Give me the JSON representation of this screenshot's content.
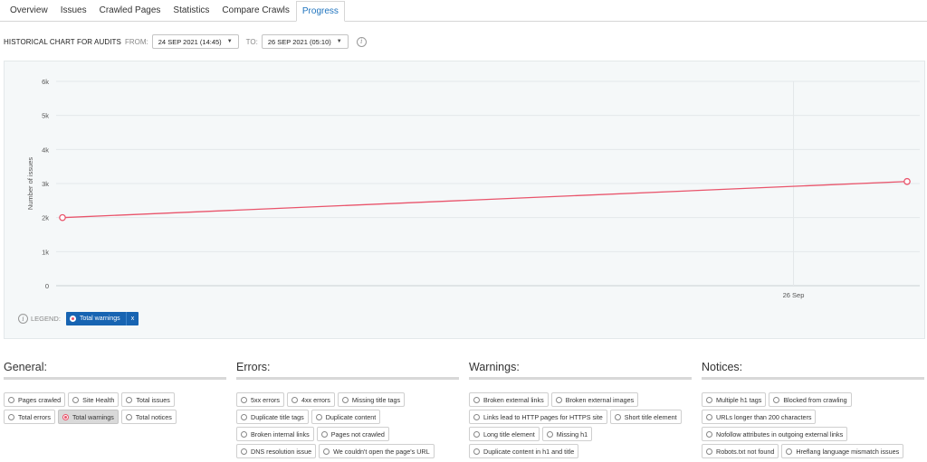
{
  "tabs": [
    {
      "label": "Overview",
      "active": false
    },
    {
      "label": "Issues",
      "active": false
    },
    {
      "label": "Crawled Pages",
      "active": false
    },
    {
      "label": "Statistics",
      "active": false
    },
    {
      "label": "Compare Crawls",
      "active": false
    },
    {
      "label": "Progress",
      "active": true
    }
  ],
  "history": {
    "title": "HISTORICAL CHART FOR AUDITS",
    "from_label": "FROM:",
    "from_value": "24 SEP 2021 (14:45)",
    "to_label": "TO:",
    "to_value": "26 SEP 2021 (05:10)"
  },
  "legend": {
    "label": "LEGEND:",
    "chip_label": "Total warnings",
    "chip_close": "x"
  },
  "colors": {
    "line": "#e9546b",
    "accent": "#1764b2",
    "tab_active": "#1e73be"
  },
  "chart_data": {
    "type": "line",
    "ylabel": "Number of issues",
    "xlabel": "",
    "ylim": [
      0,
      6000
    ],
    "yticks": [
      0,
      1000,
      2000,
      3000,
      4000,
      5000,
      6000
    ],
    "ytick_labels": [
      "0",
      "1k",
      "2k",
      "3k",
      "4k",
      "5k",
      "6k"
    ],
    "x_range": [
      "2021-09-24 14:45",
      "2021-09-26 05:10"
    ],
    "xtick_labels": [
      {
        "label": "26 Sep",
        "at": "2021-09-26 00:00"
      }
    ],
    "series": [
      {
        "name": "Total warnings",
        "x": [
          "2021-09-24 14:45",
          "2021-09-26 05:10"
        ],
        "values": [
          2000,
          3060
        ]
      }
    ]
  },
  "groups": [
    {
      "title": "General:",
      "options": [
        {
          "label": "Pages crawled",
          "selected": false
        },
        {
          "label": "Site Health",
          "selected": false
        },
        {
          "label": "Total issues",
          "selected": false
        },
        {
          "label": "Total errors",
          "selected": false
        },
        {
          "label": "Total warnings",
          "selected": true
        },
        {
          "label": "Total notices",
          "selected": false
        }
      ]
    },
    {
      "title": "Errors:",
      "options": [
        {
          "label": "5xx errors",
          "selected": false
        },
        {
          "label": "4xx errors",
          "selected": false
        },
        {
          "label": "Missing title tags",
          "selected": false
        },
        {
          "label": "Duplicate title tags",
          "selected": false
        },
        {
          "label": "Duplicate content",
          "selected": false
        },
        {
          "label": "Broken internal links",
          "selected": false
        },
        {
          "label": "Pages not crawled",
          "selected": false
        },
        {
          "label": "DNS resolution issue",
          "selected": false
        },
        {
          "label": "We couldn't open the page's URL",
          "selected": false
        }
      ]
    },
    {
      "title": "Warnings:",
      "options": [
        {
          "label": "Broken external links",
          "selected": false
        },
        {
          "label": "Broken external images",
          "selected": false
        },
        {
          "label": "Links lead to HTTP pages for HTTPS site",
          "selected": false
        },
        {
          "label": "Short title element",
          "selected": false
        },
        {
          "label": "Long title element",
          "selected": false
        },
        {
          "label": "Missing h1",
          "selected": false
        },
        {
          "label": "Duplicate content in h1 and title",
          "selected": false
        }
      ]
    },
    {
      "title": "Notices:",
      "options": [
        {
          "label": "Multiple h1 tags",
          "selected": false
        },
        {
          "label": "Blocked from crawling",
          "selected": false
        },
        {
          "label": "URLs longer than 200 characters",
          "selected": false
        },
        {
          "label": "Nofollow attributes in outgoing external links",
          "selected": false
        },
        {
          "label": "Robots.txt not found",
          "selected": false
        },
        {
          "label": "Hreflang language mismatch issues",
          "selected": false
        }
      ]
    }
  ]
}
